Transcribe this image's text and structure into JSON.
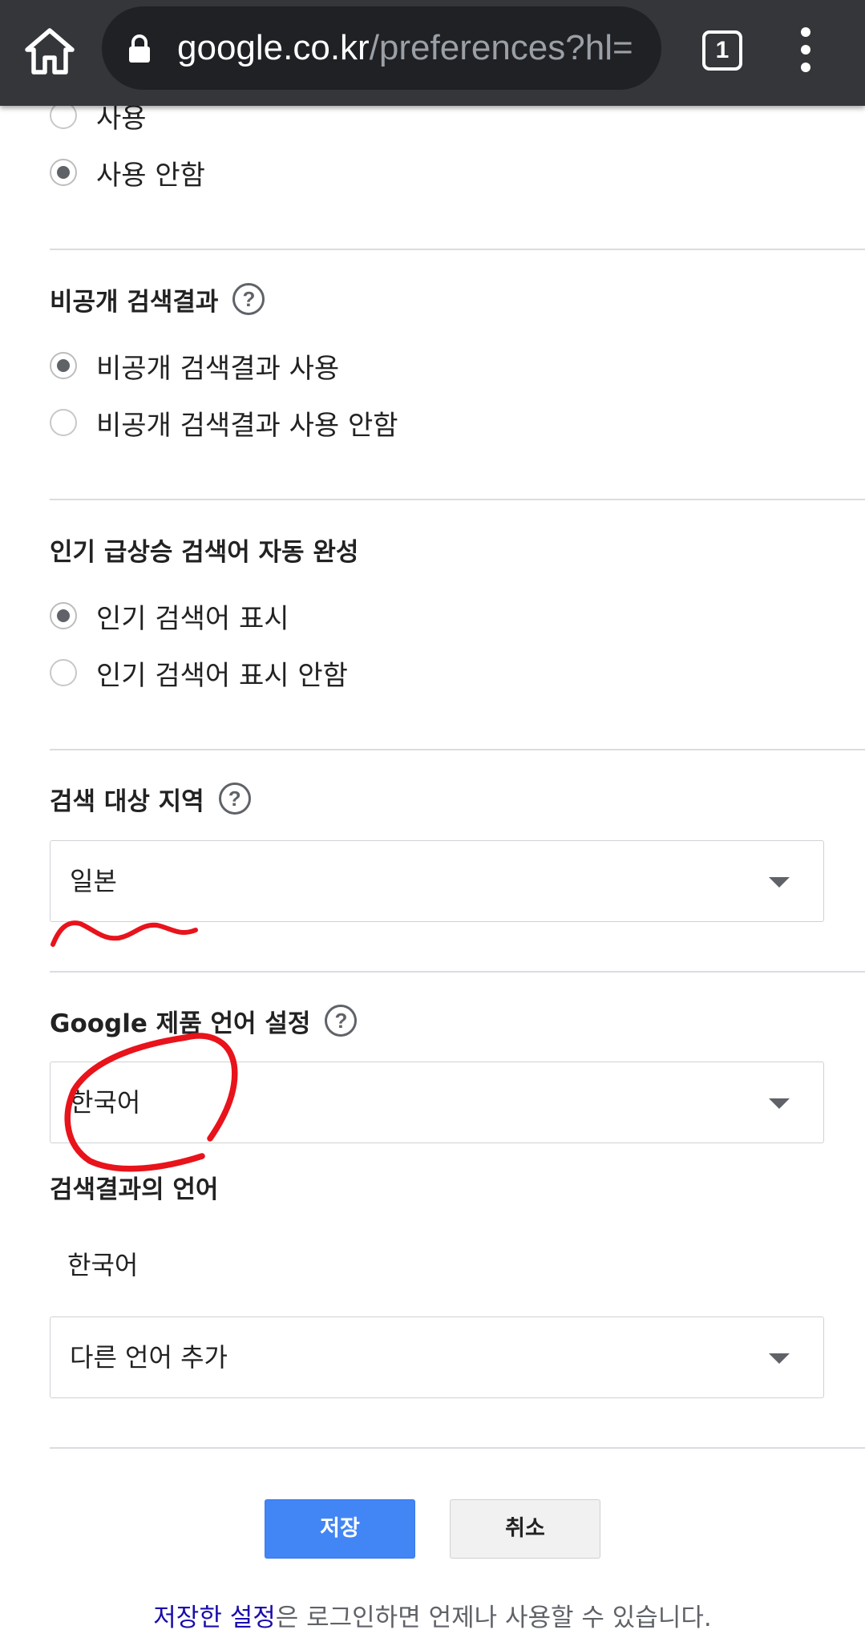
{
  "browser": {
    "url_host": "google.co.kr",
    "url_path": "/preferences?hl=",
    "tab_count": "1",
    "icons": {
      "home": "home-icon",
      "lock": "lock-icon",
      "tabs": "tab-switcher-icon",
      "menu": "more-vert-icon"
    }
  },
  "safesearch_partial": {
    "options": [
      "사용",
      "사용 안함"
    ],
    "selected": "사용 안함"
  },
  "private_results": {
    "title": "비공개 검색결과",
    "options": [
      "비공개 검색결과 사용",
      "비공개 검색결과 사용 안함"
    ],
    "selected": "비공개 검색결과 사용"
  },
  "trending": {
    "title": "인기 급상승 검색어 자동 완성",
    "options": [
      "인기 검색어 표시",
      "인기 검색어 표시 안함"
    ],
    "selected": "인기 검색어 표시"
  },
  "region": {
    "title": "검색 대상 지역",
    "value": "일본"
  },
  "product_language": {
    "title": "Google 제품 언어 설정",
    "value": "한국어"
  },
  "results_language": {
    "title": "검색결과의 언어",
    "value": "한국어",
    "add_placeholder": "다른 언어 추가"
  },
  "actions": {
    "save": "저장",
    "cancel": "취소"
  },
  "footer": {
    "link": "저장한 설정",
    "text": "은 로그인하면 언제나 사용할 수 있습니다."
  },
  "annotation_color": "#e8131b",
  "colors": {
    "primary_button": "#4285f4",
    "link": "#1a0dab",
    "toolbar": "#35363a"
  }
}
